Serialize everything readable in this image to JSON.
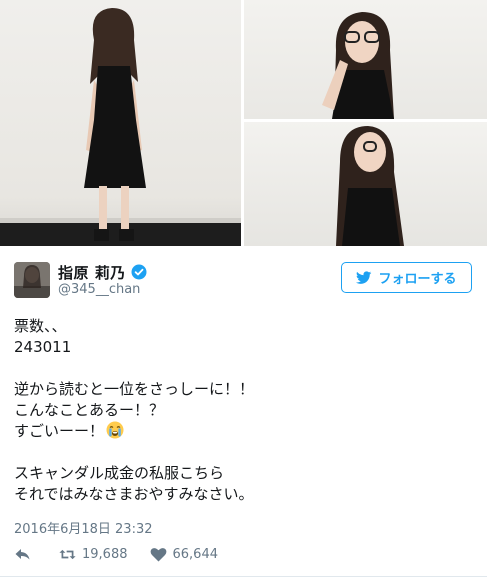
{
  "user": {
    "display_name": "指原 莉乃",
    "handle": "@345__chan",
    "verified": true
  },
  "follow_button": {
    "label": "フォローする",
    "icon": "twitter-bird-icon"
  },
  "tweet": {
    "lines": [
      "票数、、",
      "243011",
      "",
      "逆から読むと一位をさっしーに！！",
      "こんなことあるー！？",
      "すごいーー！",
      "",
      "スキャンダル成金の私服こちら",
      "それではみなさまおやすみなさい。"
    ],
    "emoji": "loudly-crying-face-emoji",
    "timestamp": "2016年6月18日 23:32"
  },
  "actions": {
    "reply_icon": "reply-icon",
    "retweet_icon": "retweet-icon",
    "retweet_count": "19,688",
    "like_icon": "heart-icon",
    "like_count": "66,644"
  },
  "colors": {
    "accent": "#1da1f2",
    "secondary_text": "#657786",
    "primary_text": "#14171a"
  }
}
